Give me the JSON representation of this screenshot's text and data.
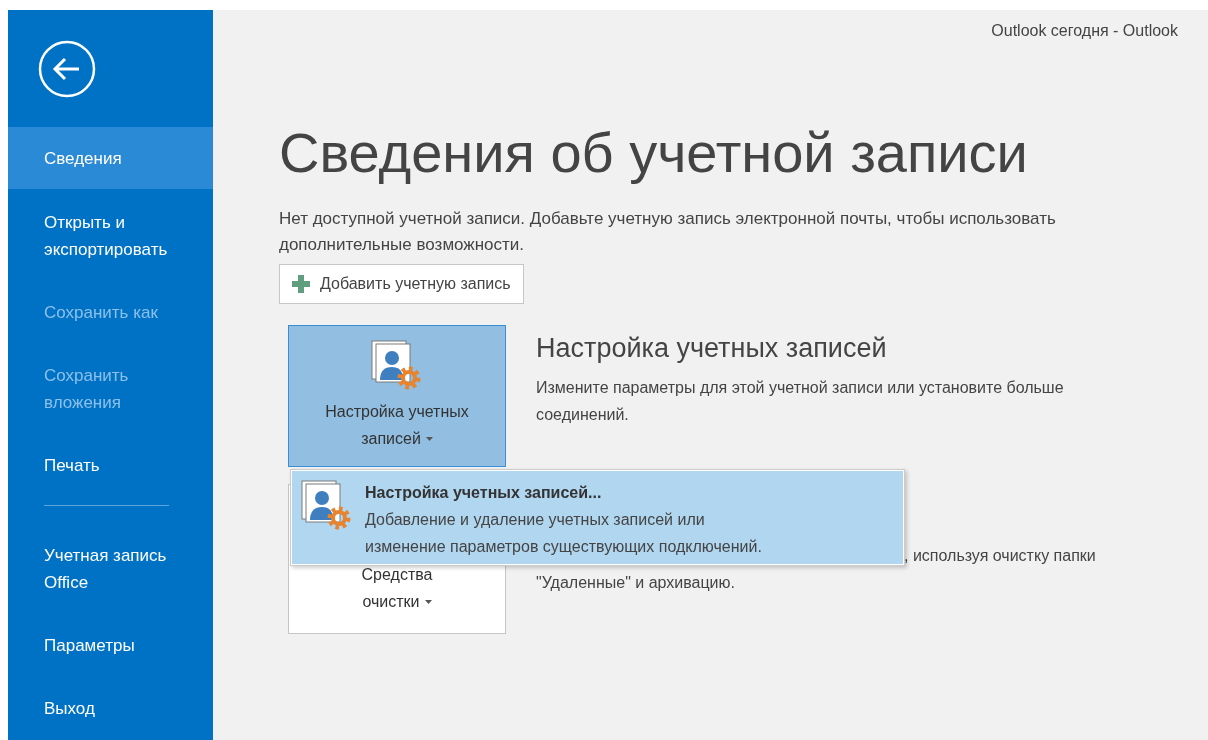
{
  "window": {
    "title": "Outlook сегодня - Outlook"
  },
  "sidebar": {
    "items": [
      {
        "kind": "item",
        "label": "Сведения",
        "selected": true,
        "disabled": false
      },
      {
        "kind": "item",
        "label": "Открыть и экспортировать",
        "selected": false,
        "disabled": false
      },
      {
        "kind": "item",
        "label": "Сохранить как",
        "selected": false,
        "disabled": true
      },
      {
        "kind": "item",
        "label": "Сохранить вложения",
        "selected": false,
        "disabled": true
      },
      {
        "kind": "item",
        "label": "Печать",
        "selected": false,
        "disabled": false
      },
      {
        "kind": "separator"
      },
      {
        "kind": "item",
        "label": "Учетная запись Office",
        "selected": false,
        "disabled": false
      },
      {
        "kind": "item",
        "label": "Параметры",
        "selected": false,
        "disabled": false
      },
      {
        "kind": "item",
        "label": "Выход",
        "selected": false,
        "disabled": false
      }
    ]
  },
  "page": {
    "title": "Сведения об учетной записи",
    "notice": "Нет доступной учетной записи. Добавьте учетную запись электронной почты, чтобы использовать дополнительные возможности.",
    "add_button": {
      "label": "Добавить учетную запись"
    }
  },
  "sections": [
    {
      "button_label": "Настройка учетных записей",
      "selected": true,
      "heading": "Настройка учетных записей",
      "lines": [
        "Измените параметры для этой учетной записи или установите больше",
        "соединений."
      ]
    },
    {
      "button_label": "Средства очистки",
      "selected": false,
      "lines": [
        ", используя очистку папки",
        "\"Удаленные\" и архивацию."
      ]
    }
  ],
  "dropdown_menu": {
    "items": [
      {
        "title": "Настройка учетных записей...",
        "lines": [
          "Добавление и удаление учетных записей или",
          "изменение параметров существующих подключений."
        ],
        "selected": true
      }
    ]
  }
}
